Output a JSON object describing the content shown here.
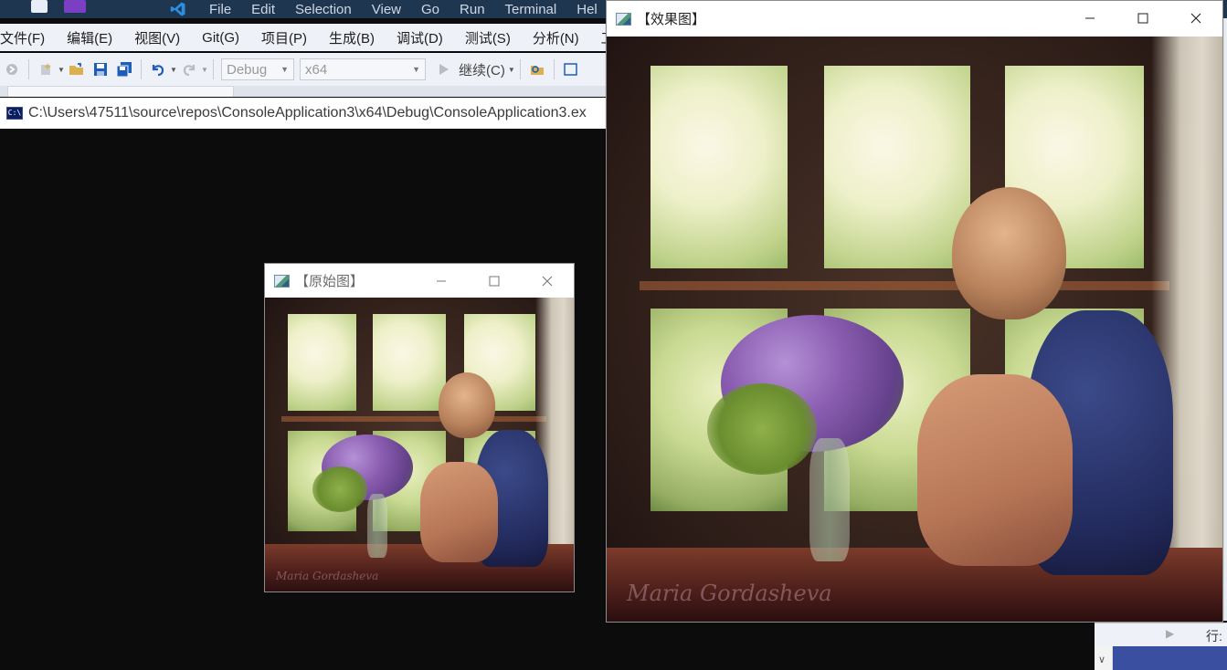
{
  "vscode": {
    "menu": [
      "File",
      "Edit",
      "Selection",
      "View",
      "Go",
      "Run",
      "Terminal",
      "Hel"
    ]
  },
  "vs": {
    "menu": [
      "文件(F)",
      "编辑(E)",
      "视图(V)",
      "Git(G)",
      "项目(P)",
      "生成(B)",
      "调试(D)",
      "测试(S)",
      "分析(N)",
      "工"
    ],
    "toolbar": {
      "config": "Debug",
      "platform": "x64",
      "continue": "继续(C)"
    },
    "status": {
      "row_label": "行:"
    }
  },
  "console": {
    "icon_text": "C:\\",
    "path": "C:\\Users\\47511\\source\\repos\\ConsoleApplication3\\x64\\Debug\\ConsoleApplication3.ex"
  },
  "windows": {
    "original": {
      "title": "【原始图】"
    },
    "effect": {
      "title": "【效果图】"
    }
  },
  "photo": {
    "signature": "Maria Gordasheva"
  },
  "colors": {
    "vscode_bar": "#1f3650",
    "vs_chrome": "#eef1f7",
    "console_bg": "#0c0c0c",
    "accent_blue": "#3b4fa0"
  }
}
